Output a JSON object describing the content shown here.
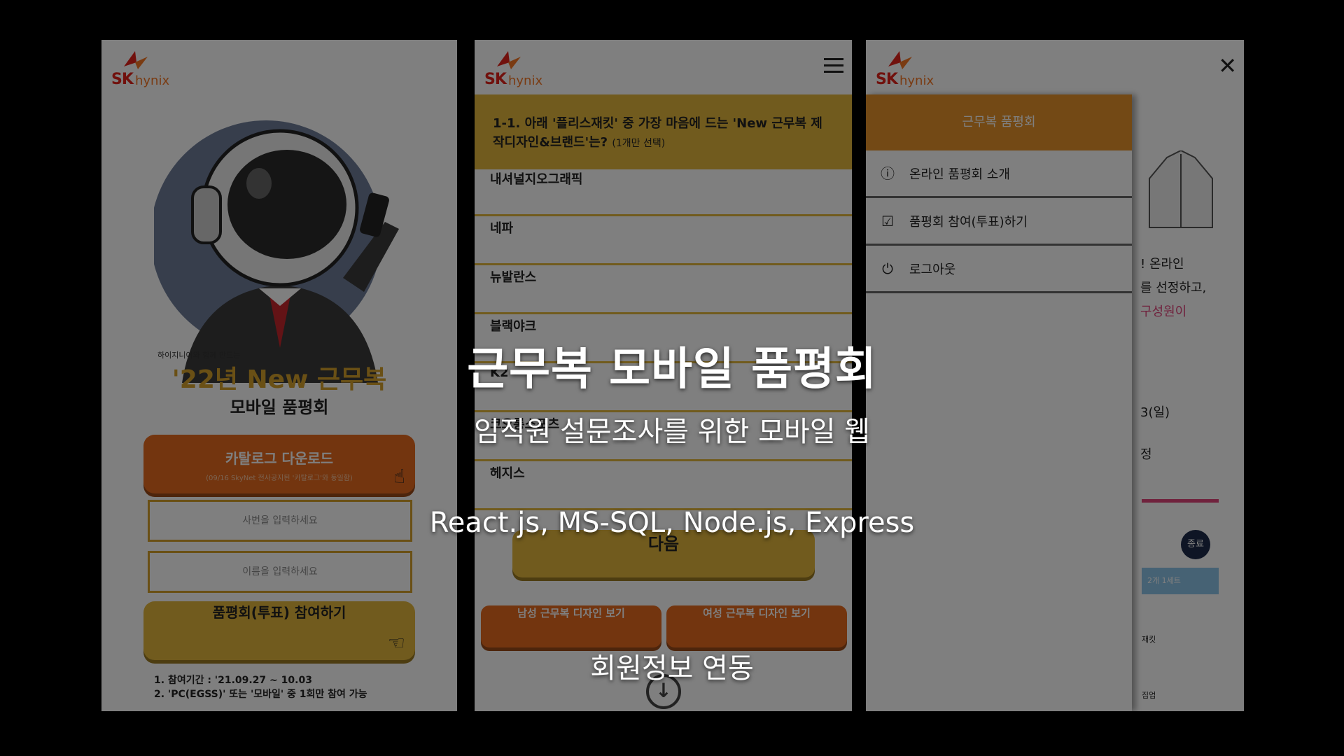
{
  "brand": {
    "sk": "SK",
    "hynix": "hynix"
  },
  "panel1": {
    "small_caption": "하이지니어와 함께 만드는",
    "title": "'22년 New 근무복",
    "subtitle": "모바일 품평회",
    "catalog_button": "카탈로그 다운로드",
    "catalog_note": "(09/16 SkyNet 전사공지된 '카탈로그'와 동일함)",
    "id_placeholder": "사번을 입력하세요",
    "name_placeholder": "이름을 입력하세요",
    "vote_button": "품평회(투표) 참여하기",
    "info1": "1. 참여기간 : '21.09.27 ~ 10.03",
    "info2": "2. 'PC(EGSS)' 또는 '모바일' 중 1회만 참여 가능"
  },
  "panel2": {
    "question": "1-1. 아래 '플리스재킷' 중 가장 마음에 드는 'New 근무복 제작디자인&브랜드'는?",
    "question_hint": "(1개만 선택)",
    "options": [
      "내셔널지오그래픽",
      "네파",
      "뉴발란스",
      "블랙야크",
      "K2",
      "코오롱스포츠",
      "헤지스"
    ],
    "next_button": "다음",
    "male_button": "남성 근무복 디자인 보기",
    "female_button": "여성 근무복 디자인 보기"
  },
  "panel3": {
    "drawer_title": "근무복 품평회",
    "menu": [
      {
        "icon": "info-icon",
        "label": "온라인 품평회 소개"
      },
      {
        "icon": "clipboard-check-icon",
        "label": "품평회 참여(투표)하기"
      },
      {
        "icon": "power-icon",
        "label": "로그아웃"
      }
    ],
    "bg_lines": [
      "! 온라인",
      "를 선정하고,",
      "구성원이",
      "3(일)",
      "정"
    ],
    "bg_badge": "종료",
    "bg_tab": "2개 1세트",
    "bg_labels": [
      "재킷",
      "집업"
    ]
  },
  "hero": {
    "title": "근무복 모바일 품평회",
    "subtitle": "임직원 설문조사를 위한 모바일 웹",
    "tech": "React.js, MS-SQL, Node.js, Express",
    "feature": "회원정보 연동"
  },
  "colors": {
    "gold": "#e3b63c",
    "orange": "#e66a1e",
    "drawer": "#e6922a",
    "pink": "#e0457b"
  }
}
